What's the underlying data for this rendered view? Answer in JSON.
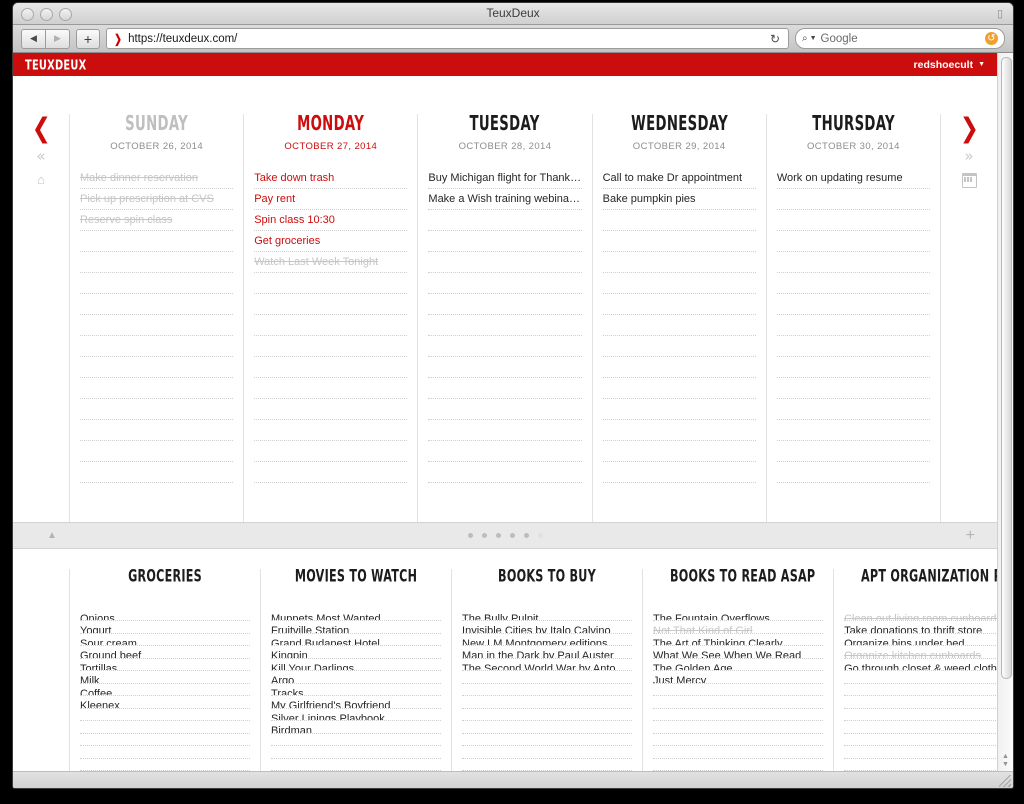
{
  "browser": {
    "window_title": "TeuxDeux",
    "url": "https://teuxdeux.com/",
    "search_placeholder": "Google",
    "back_glyph": "◀",
    "forward_glyph": "▶",
    "new_tab_glyph": "+",
    "favicon_glyph": "❯",
    "reload_glyph": "↻",
    "search_glass_glyph": "⌕",
    "search_caret_glyph": "▼",
    "restore_glyph": "↺",
    "lock_glyph": "▯"
  },
  "app_header": {
    "logo": "TEUXDEUX",
    "account_name": "redshoecult",
    "account_caret": "▼"
  },
  "left_nav": {
    "prev_arrow": "❮",
    "jump_back": "«",
    "home_glyph": "⌂"
  },
  "right_nav": {
    "next_arrow": "❯",
    "jump_forward": "»"
  },
  "lists_nav": {
    "next_arrow": "❯",
    "jump_forward": "»"
  },
  "divider": {
    "collapse_glyph": "▲",
    "add_list_glyph": "+",
    "dot_count": 6,
    "active_dots": 5
  },
  "days": [
    {
      "name": "SUNDAY",
      "date": "OCTOBER 26, 2014",
      "state": "past",
      "todos": [
        {
          "text": "Make dinner reservation",
          "done": true
        },
        {
          "text": "Pick up prescription at CVS",
          "done": true
        },
        {
          "text": "Reserve spin class",
          "done": true
        }
      ]
    },
    {
      "name": "MONDAY",
      "date": "OCTOBER 27, 2014",
      "state": "today",
      "todos": [
        {
          "text": "Take down trash",
          "done": false
        },
        {
          "text": "Pay rent",
          "done": false
        },
        {
          "text": "Spin class 10:30",
          "done": false
        },
        {
          "text": "Get groceries",
          "done": false
        },
        {
          "text": "Watch Last Week Tonight",
          "done": true
        }
      ]
    },
    {
      "name": "TUESDAY",
      "date": "OCTOBER 28, 2014",
      "state": "future",
      "todos": [
        {
          "text": "Buy Michigan flight for Thanksgiving",
          "done": false
        },
        {
          "text": "Make a Wish training webinar - Noon",
          "done": false
        }
      ]
    },
    {
      "name": "WEDNESDAY",
      "date": "OCTOBER 29, 2014",
      "state": "future",
      "todos": [
        {
          "text": "Call to make Dr appointment",
          "done": false
        },
        {
          "text": "Bake pumpkin pies",
          "done": false
        }
      ]
    },
    {
      "name": "THURSDAY",
      "date": "OCTOBER 30, 2014",
      "state": "future",
      "todos": [
        {
          "text": "Work on updating resume",
          "done": false
        }
      ]
    }
  ],
  "lists": [
    {
      "title": "GROCERIES",
      "items": [
        {
          "text": "Onions",
          "done": false
        },
        {
          "text": "Yogurt",
          "done": false
        },
        {
          "text": "Sour cream",
          "done": false
        },
        {
          "text": "Ground beef",
          "done": false
        },
        {
          "text": "Tortillas",
          "done": false
        },
        {
          "text": "Milk",
          "done": false
        },
        {
          "text": "Coffee",
          "done": false
        },
        {
          "text": "Kleenex",
          "done": false
        }
      ]
    },
    {
      "title": "MOVIES TO WATCH",
      "items": [
        {
          "text": "Muppets Most Wanted",
          "done": false
        },
        {
          "text": "Fruitville Station",
          "done": false
        },
        {
          "text": "Grand Budapest Hotel",
          "done": false
        },
        {
          "text": "Kingpin",
          "done": false
        },
        {
          "text": "Kill Your Darlings",
          "done": false
        },
        {
          "text": "Argo",
          "done": false
        },
        {
          "text": "Tracks",
          "done": false
        },
        {
          "text": "My Girlfriend's Boyfriend",
          "done": false
        },
        {
          "text": "Silver Linings Playbook",
          "done": false
        },
        {
          "text": "Birdman",
          "done": false
        }
      ]
    },
    {
      "title": "BOOKS TO BUY",
      "items": [
        {
          "text": "The Bully Pulpit",
          "done": false
        },
        {
          "text": "Invisible Cities by Italo Calvino",
          "done": false
        },
        {
          "text": "New LM Montgomery editions",
          "done": false
        },
        {
          "text": "Man in the Dark by Paul Auster",
          "done": false
        },
        {
          "text": "The Second World War by Antony ...",
          "done": false
        }
      ]
    },
    {
      "title": "BOOKS TO READ ASAP",
      "items": [
        {
          "text": "The Fountain Overflows",
          "done": false
        },
        {
          "text": "Not That Kind of Girl",
          "done": true
        },
        {
          "text": "The Art of Thinking Clearly",
          "done": false
        },
        {
          "text": "What We See When We Read",
          "done": false
        },
        {
          "text": "The Golden Age",
          "done": false
        },
        {
          "text": "Just Mercy",
          "done": false
        }
      ]
    },
    {
      "title": "APT ORGANIZATION PROJECTS",
      "items": [
        {
          "text": "Clean out living room cupboards",
          "done": true
        },
        {
          "text": "Take donations to thrift store",
          "done": false
        },
        {
          "text": "Organize bins under bed",
          "done": false
        },
        {
          "text": "Organize kitchen cupboards",
          "done": true
        },
        {
          "text": "Go through closet & weed clothing",
          "done": false
        }
      ]
    }
  ],
  "colors": {
    "brand_red": "#cc0d0d",
    "done_gray": "#c6c6c6",
    "text": "#262626"
  }
}
